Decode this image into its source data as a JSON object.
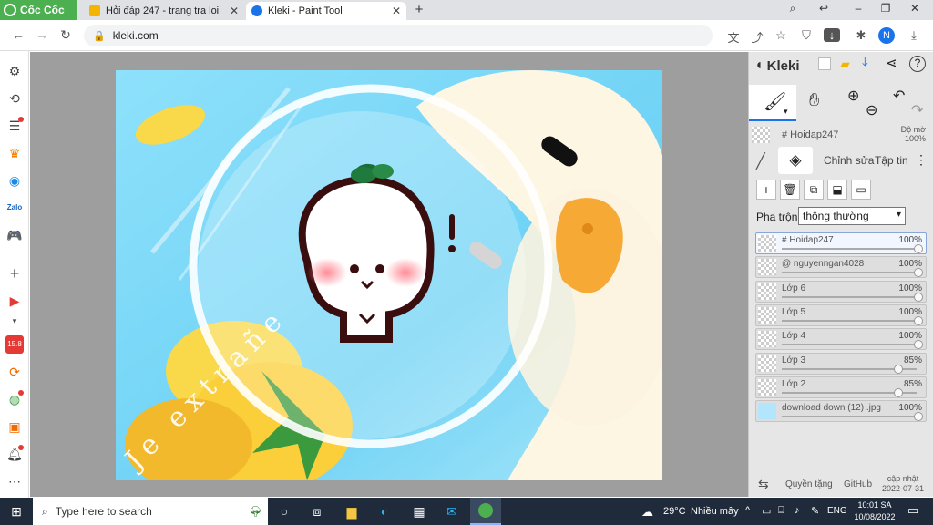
{
  "browser": {
    "brand": "Cốc Cốc",
    "tabs": [
      {
        "title": "Hỏi đáp 247 - trang tra loi",
        "favicon_color": "#f4b400"
      },
      {
        "title": "Kleki - Paint Tool",
        "favicon_color": "#1a73e8"
      }
    ],
    "new_tab": "+",
    "url": "kleki.com",
    "profile_initial": "N"
  },
  "app": {
    "name": "Kleki",
    "layer_name_field": "# Hoidap247",
    "opacity_label": "Độ mờ",
    "opacity_value": "100%",
    "tabs": {
      "edit": "Chỉnh sửa",
      "file": "Tập tin"
    },
    "blend_label": "Pha trộn",
    "blend_value": "thông thường",
    "layers": [
      {
        "name": "# Hoidap247",
        "opacity": "100%",
        "level": 1.0,
        "active": true
      },
      {
        "name": "@ nguyenngan4028",
        "opacity": "100%",
        "level": 1.0
      },
      {
        "name": "Lớp 6",
        "opacity": "100%",
        "level": 1.0
      },
      {
        "name": "Lớp 5",
        "opacity": "100%",
        "level": 1.0
      },
      {
        "name": "Lớp 4",
        "opacity": "100%",
        "level": 1.0
      },
      {
        "name": "Lớp 3",
        "opacity": "85%",
        "level": 0.85
      },
      {
        "name": "Lớp 2",
        "opacity": "85%",
        "level": 0.85
      },
      {
        "name": "download down (12) .jpg",
        "opacity": "100%",
        "level": 1.0
      }
    ],
    "footer": {
      "privacy": "Quyền tặng",
      "github": "GitHub",
      "updated_label": "cập nhật",
      "updated_date": "2022-07-31"
    }
  },
  "canvas_art": {
    "text": "Je extrañe"
  },
  "taskbar": {
    "search_placeholder": "Type here to search",
    "weather_temp": "29°C",
    "weather_desc": "Nhiều mây",
    "lang": "ENG",
    "time": "10:01 SA",
    "date": "10/08/2022"
  },
  "colors": {
    "accent": "#1a73e8",
    "coccoc_green": "#4caf50",
    "canvas_sky": "#7fd8f7"
  }
}
